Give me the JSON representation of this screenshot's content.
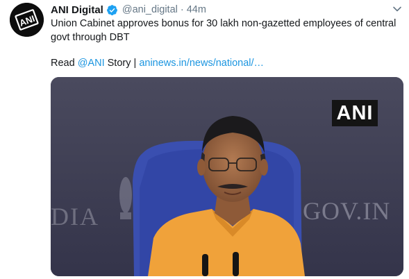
{
  "tweet": {
    "display_name": "ANI Digital",
    "handle": "@ani_digital",
    "separator": "·",
    "time": "44m",
    "text": "Union Cabinet approves bonus for 30 lakh non-gazetted employees of central govt through DBT",
    "read_prefix": "Read",
    "mention": "@ANI",
    "story_word": "Story |",
    "link_text": "aninews.in/news/national/…"
  },
  "avatar": {
    "logo_text": "ANI"
  },
  "media": {
    "watermark": "ANI",
    "background_text_left": "DIA",
    "background_text_right": "GOV.IN"
  },
  "icons": {
    "verified": "verified-badge-icon",
    "caret": "chevron-down-icon"
  },
  "colors": {
    "link": "#1b95e0",
    "secondary_text": "#657786",
    "verified": "#1da1f2",
    "kurta": "#f0a23a",
    "chair": "#3a4fb0"
  }
}
